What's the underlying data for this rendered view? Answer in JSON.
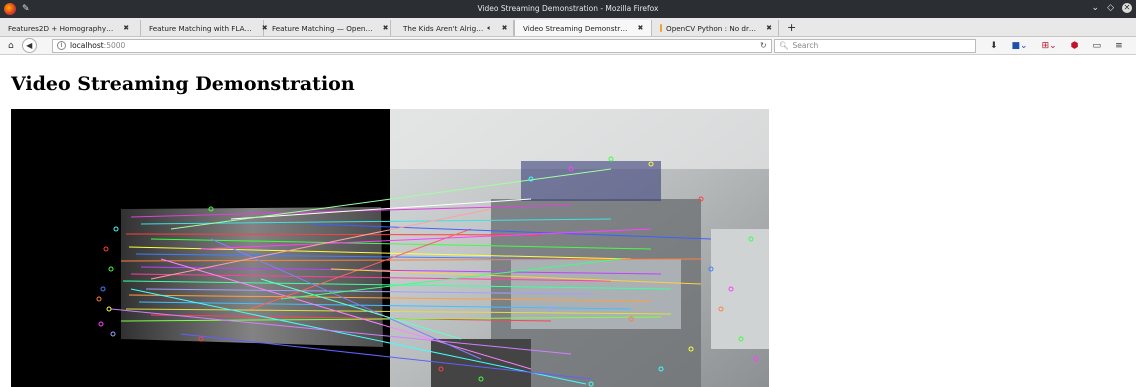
{
  "window": {
    "title": "Video Streaming Demonstration - Mozilla Firefox"
  },
  "tabs": [
    {
      "label": "Features2D + Homography…",
      "active": false
    },
    {
      "label": "Feature Matching with FLA…",
      "active": false
    },
    {
      "label": "Feature Matching — Open…",
      "active": false
    },
    {
      "label": "The Kids Aren't Alrig…",
      "active": false
    },
    {
      "label": "Video Streaming Demonstr…",
      "active": true
    },
    {
      "label": "OpenCV Python : No dr…",
      "active": false
    }
  ],
  "new_tab_label": "+",
  "urlbar": {
    "host": "localhost",
    "port": ":5000"
  },
  "search": {
    "placeholder": "Search"
  },
  "page": {
    "heading": "Video Streaming Demonstration"
  },
  "icons": {
    "home": "home-icon",
    "back": "back-arrow-icon",
    "reload": "reload-icon",
    "downloads": "download-icon",
    "pocket": "save-icon",
    "addon": "addon-icon",
    "shield": "ublock-icon",
    "sidebar": "sidebar-icon",
    "menu": "hamburger-menu-icon"
  },
  "colors": {
    "titlebar": "#2b2e33",
    "tabstrip": "#e8e8e8",
    "link_active": "#1f4fa8"
  }
}
